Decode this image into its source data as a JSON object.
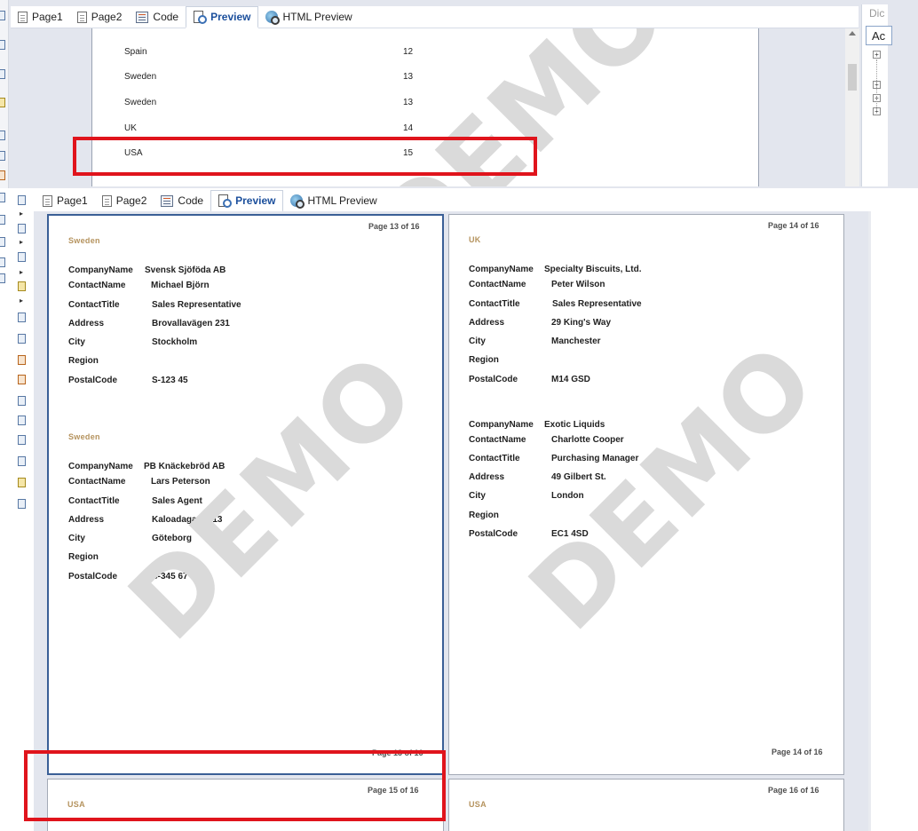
{
  "tabs_top": [
    {
      "label": "Page1",
      "icon": "page-icon"
    },
    {
      "label": "Page2",
      "icon": "page-icon"
    },
    {
      "label": "Code",
      "icon": "code-icon"
    },
    {
      "label": "Preview",
      "icon": "preview-icon",
      "active": true
    },
    {
      "label": "HTML Preview",
      "icon": "html-preview-icon"
    }
  ],
  "tabs_bottom": [
    {
      "label": "Page1",
      "icon": "page-icon"
    },
    {
      "label": "Page2",
      "icon": "page-icon"
    },
    {
      "label": "Code",
      "icon": "code-icon"
    },
    {
      "label": "Preview",
      "icon": "preview-icon",
      "active": true
    },
    {
      "label": "HTML Preview",
      "icon": "html-preview-icon"
    }
  ],
  "dictionary": {
    "title": "Dic",
    "field": "Ac"
  },
  "top_table": [
    {
      "country": "Spain",
      "value": "12"
    },
    {
      "country": "Sweden",
      "value": "13"
    },
    {
      "country": "Sweden",
      "value": "13"
    },
    {
      "country": "UK",
      "value": "14"
    },
    {
      "country": "USA",
      "value": "15"
    }
  ],
  "watermark": "DEMO",
  "labels": {
    "company": "CompanyName",
    "contact": "ContactName",
    "title": "ContactTitle",
    "address": "Address",
    "city": "City",
    "region": "Region",
    "postal": "PostalCode"
  },
  "pages": {
    "p13": {
      "header": "Page 13 of 16",
      "footer": "Page 13 of 16",
      "groups": [
        {
          "country": "Sweden",
          "company": "Svensk Sjöföda AB",
          "contact": "Michael Björn",
          "title": "Sales Representative",
          "address": "Brovallavägen 231",
          "city": "Stockholm",
          "region": "",
          "postal": "S-123 45"
        },
        {
          "country": "Sweden",
          "company": "PB Knäckebröd AB",
          "contact": "Lars Peterson",
          "title": "Sales Agent",
          "address": "Kaloadagatan 13",
          "city": "Göteborg",
          "region": "",
          "postal": "S-345 67"
        }
      ]
    },
    "p14": {
      "header": "Page 14 of 16",
      "footer": "Page 14 of 16",
      "country": "UK",
      "groups": [
        {
          "company": "Specialty Biscuits, Ltd.",
          "contact": "Peter Wilson",
          "title": "Sales Representative",
          "address": "29 King's Way",
          "city": "Manchester",
          "region": "",
          "postal": "M14 GSD"
        },
        {
          "company": "Exotic Liquids",
          "contact": "Charlotte Cooper",
          "title": "Purchasing Manager",
          "address": "49 Gilbert St.",
          "city": "London",
          "region": "",
          "postal": "EC1 4SD"
        }
      ]
    },
    "p15": {
      "header": "Page 15 of 16",
      "country": "USA"
    },
    "p16": {
      "header": "Page 16 of 16",
      "country": "USA"
    }
  },
  "colors": {
    "highlight": "#e0141c",
    "country_label": "#b5935e",
    "active_tab": "#1b4f9c",
    "page_border_selected": "#3a5f96"
  }
}
